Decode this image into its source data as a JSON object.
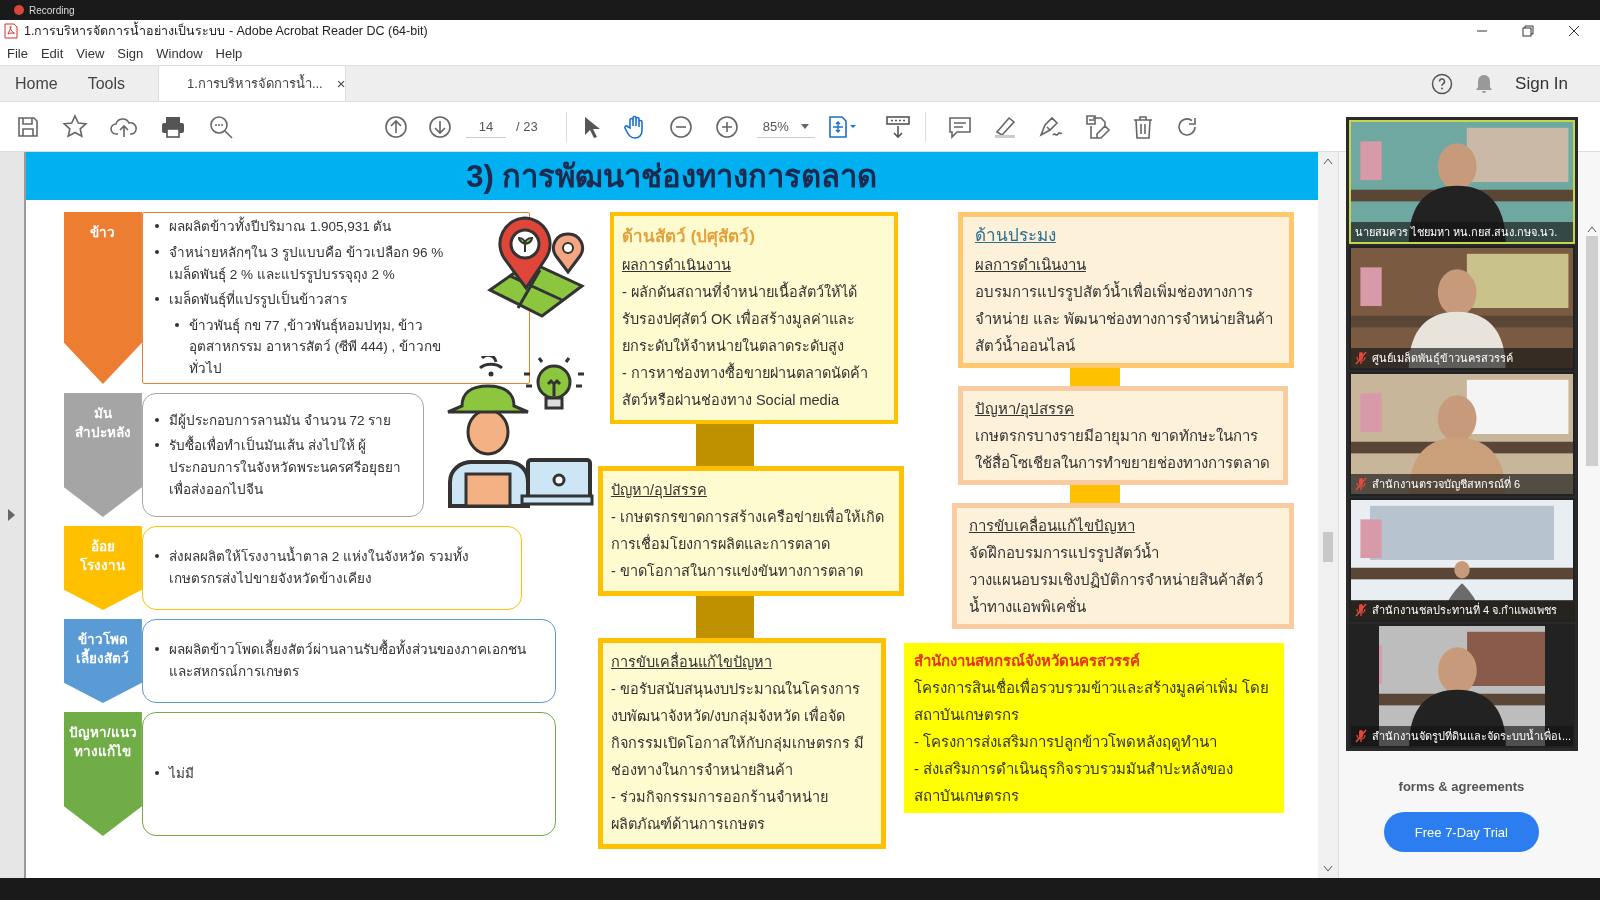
{
  "recording": "Recording",
  "window": {
    "title": "1.การบริหารจัดการน้ำอย่างเป็นระบบ - Adobe Acrobat Reader DC (64-bit)"
  },
  "menu": [
    "File",
    "Edit",
    "View",
    "Sign",
    "Window",
    "Help"
  ],
  "tabs": [
    {
      "label": "Home",
      "selected": false
    },
    {
      "label": "Tools",
      "selected": false
    },
    {
      "label": "1.การบริหารจัดการน้ำ...",
      "selected": true,
      "close": "×"
    }
  ],
  "account": {
    "sign_in": "Sign In"
  },
  "toolbar": {
    "page": "14",
    "pages": "/ 23",
    "zoom": "85%",
    "tools": [
      {
        "kind": "pointer",
        "selected": false
      },
      {
        "kind": "hand",
        "selected": true
      }
    ]
  },
  "slide": {
    "title": "3) การพัฒนาช่องทางการตลาด",
    "products": [
      {
        "label": [
          "ข้าว"
        ],
        "color": "#ed7d31",
        "bullets": [
          {
            "text": "ผลผลิตข้าวทั้งปีปริมาณ 1.905,931 ตัน"
          },
          {
            "text": "จำหน่ายหลักๆใน 3 รูปแบบคือ  ข้าวเปลือก 96 % เมล็ดพันธุ์ 2 % และแปรรูปบรรจุถุง 2 %"
          },
          {
            "text": "เมล็ดพันธุ์ที่แปรรูปเป็นข้าวสาร",
            "children": [
              {
                "text": "ข้าวพันธุ์ กข 77 ,ข้าวพันธุ์หอมปทุม,  ข้าวอุตสาหกรรม อาหารสัตว์ (ซีพี 444) ,   ข้าวกข ทั่วไป"
              }
            ]
          }
        ]
      },
      {
        "label": [
          "มัน",
          "สำปะหลัง"
        ],
        "color": "#a5a5a5",
        "bullets": [
          {
            "text": "มีผู้ประกอบการลานมัน จำนวน 72 ราย"
          },
          {
            "text": "รับซื้อเพื่อทำเป็นมันเส้น ส่งไปให้ ผู้ประกอบการในจังหวัดพระนครศรีอยุธยา เพื่อส่งออกไปจีน"
          }
        ]
      },
      {
        "label": [
          "อ้อย",
          "โรงงาน"
        ],
        "color": "#ffc000",
        "bullets": [
          {
            "text": "ส่งผลผลิตให้โรงงานน้ำตาล 2 แห่งในจังหวัด รวมทั้งเกษตรกรส่งไปขายจังหวัดข้างเคียง"
          }
        ]
      },
      {
        "label": [
          "ข้าวโพด",
          "เลี้ยงสัตว์"
        ],
        "color": "#5b9bd5",
        "bullets": [
          {
            "text": "ผลผลิตข้าวโพดเลี้ยงสัตว์ผ่านลานรับซื้อทั้งส่วนของภาคเอกชนและสหกรณ์การเกษตร"
          }
        ]
      },
      {
        "label": [
          "ปัญหา/แนว",
          "ทางแก้ไข"
        ],
        "color": "#70ad47",
        "bullets": [
          {
            "text": "ไม่มี"
          }
        ]
      }
    ],
    "livestock": {
      "heading": "ด้านสัตว์ (ปศุสัตว์)",
      "sections": [
        {
          "heading": "ผลการดำเนินงาน",
          "lines": [
            "-  ผลักดันสถานที่จำหน่ายเนื้อสัตว์ให้ได้รับรองปศุสัตว์ OK เพื่อสร้างมูลค่าและ",
            "ยกระดับให้จำหน่ายในตลาดระดับสูง",
            "- การหาช่องทางซื้อขายผ่านตลาดนัดค้าสัตว์หรือผ่านช่องทาง Social media"
          ]
        },
        {
          "heading": "ปัญหา/อุปสรรค",
          "lines": [
            "- เกษตรกรขาดการสร้างเครือข่ายเพื่อให้เกิดการเชื่อมโยงการผลิตและการตลาด",
            "- ขาดโอกาสในการแข่งขันทางการตลาด"
          ]
        },
        {
          "heading": "การขับเคลื่อนแก้ไขปัญหา",
          "lines": [
            "- ขอรับสนับสนุนงบประมาณในโครงการงบพัฒนาจังหวัด/งบกลุ่มจังหวัด เพื่อจัดกิจกรรมเปิดโอกาสให้กับกลุ่มเกษตรกร มีช่องทางในการจำหน่ายสินค้า",
            "- ร่วมกิจกรรมการออกร้านจำหน่ายผลิตภัณฑ์ด้านการเกษตร"
          ]
        }
      ]
    },
    "fishery": {
      "heading": "ด้านประมง",
      "sections": [
        {
          "heading": "ผลการดำเนินงาน",
          "lines": [
            "อบรมการแปรรูปสัตว์น้ำเพื่อเพิ่มช่องทางการจำหน่าย และ พัฒนาช่องทางการจำหน่ายสินค้าสัตว์น้ำออนไลน์"
          ]
        },
        {
          "heading": "ปัญหา/อุปสรรค",
          "lines": [
            "เกษตรกรบางรายมีอายุมาก ขาดทักษะในการใช้สื่อโซเชียลในการทำขยายช่องทางการตลาด"
          ]
        },
        {
          "heading": "การขับเคลื่อนแก้ไขปัญหา",
          "lines": [
            "จัดฝึกอบรมการแปรรูปสัตว์น้ำ",
            "วางแผนอบรมเชิงปฏิบัติการจำหน่ายสินค้าสัตว์น้ำทางแอพพิเคชั่น"
          ]
        }
      ]
    },
    "cooperative": {
      "heading": "สำนักงานสหกรณ์จังหวัดนครสวรรค์",
      "lines": [
        "โครงการสินเชื่อเพื่อรวบรวมข้าวและสร้างมูลค่าเพิ่ม โดยสถาบันเกษตรกร",
        "- โครงการส่งเสริมการปลูกข้าวโพดหลังฤดูทำนา",
        "- ส่งเสริมการดำเนินธุรกิจรวบรวมมันสำปะหลังของสถาบันเกษตรกร"
      ]
    }
  },
  "video_tiles": [
    {
      "name": "นายสมควร ไชยมหา หน.กยส.สนง.กษจ.นว.",
      "muted": false,
      "active": true
    },
    {
      "name": "ศูนย์เมล็ดพันธุ์ข้าวนครสวรรค์",
      "muted": true,
      "active": false
    },
    {
      "name": "สำนักงานตรวจบัญชีสหกรณ์ที่ 6",
      "muted": true,
      "active": false
    },
    {
      "name": "สำนักงานชลประทานที่ 4 จ.กำแพงเพชร",
      "muted": true,
      "active": false
    },
    {
      "name": "สำนักงานจัดรูปที่ดินและจัดระบบน้ำเพื่อเ...",
      "muted": true,
      "active": false
    }
  ],
  "promo": {
    "text": "forms & agreements",
    "button": "Free 7-Day Trial"
  }
}
